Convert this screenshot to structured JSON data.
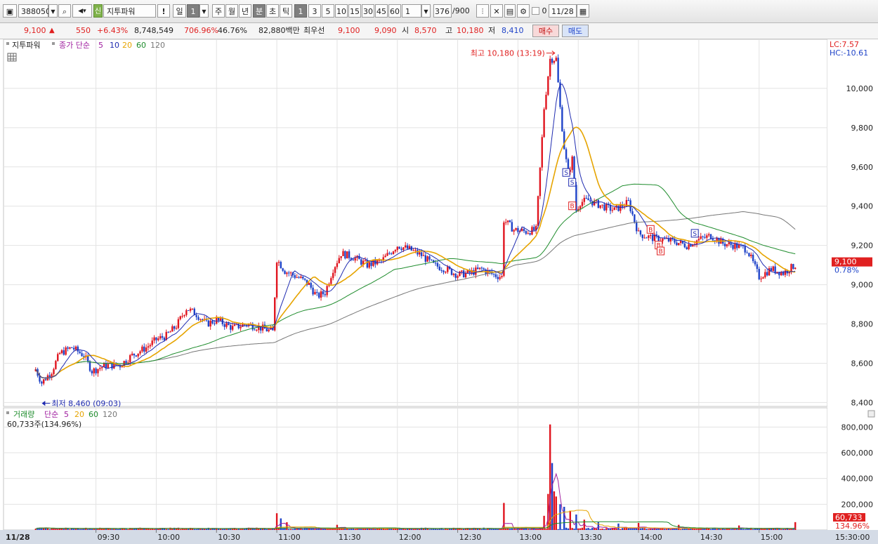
{
  "toolbar": {
    "code": "388050",
    "badge": "신",
    "name": "지투파워",
    "exclaim": "!",
    "period_day": "일",
    "period_day_num": "1",
    "period_week": "주",
    "period_month": "월",
    "period_year": "년",
    "period_minute": "분",
    "period_second": "초",
    "period_tick": "틱",
    "intervals": [
      "1",
      "3",
      "5",
      "10",
      "15",
      "30",
      "45",
      "60"
    ],
    "interval_input": "1",
    "count": "376",
    "count_total": "/900",
    "zero_label": "0",
    "date": "11/28"
  },
  "quote": {
    "price": "9,100",
    "change": "550",
    "change_pct": "+6.43%",
    "volume": "8,748,549",
    "volume_ratio": "706.96%",
    "turnover": "46.76%",
    "amount": "82,880백만",
    "best_label": "최우선",
    "ask": "9,100",
    "bid": "9,090",
    "open_label": "시",
    "open": "8,570",
    "high_label": "고",
    "high": "10,180",
    "low_label": "저",
    "low": "8,410",
    "buy_label": "매수",
    "sell_label": "매도"
  },
  "price_panel": {
    "title": "지투파워",
    "ma_label": "종가 단순",
    "ma_periods": [
      "5",
      "10",
      "20",
      "60",
      "120"
    ],
    "ma_colors": [
      "#1f2bb0",
      "#e6a400",
      "#1e8c2c",
      "#777777"
    ],
    "lc": "LC:7.57",
    "hc": "HC:-10.61",
    "high_annotation": "최고 10,180 (13:19)",
    "low_annotation": "최저 8,460 (09:03)",
    "current_price_tag": "9,100",
    "current_pct_tag": "0.78%",
    "signals": [
      "S",
      "S",
      "B",
      "B",
      "B",
      "B",
      "S"
    ]
  },
  "volume_panel": {
    "title": "거래량",
    "ma_label": "단순",
    "ma_periods": [
      "5",
      "20",
      "60",
      "120"
    ],
    "readout": "60,733주(134.96%)",
    "current_tag": "60,733",
    "current_pct_tag": "134.96%"
  },
  "time_axis": {
    "date_label": "11/28",
    "end_label": "15:30:00"
  },
  "colors": {
    "up": "#e0141e",
    "down": "#1f43c8",
    "accent": "#e02020"
  },
  "chart_data": [
    {
      "type": "candlestick",
      "title": "지투파워 1분",
      "x_ticks": [
        "09:30",
        "10:00",
        "10:30",
        "11:00",
        "11:30",
        "12:00",
        "12:30",
        "13:00",
        "13:30",
        "14:00",
        "14:30",
        "15:00"
      ],
      "y_ticks": [
        8400,
        8600,
        8800,
        9000,
        9200,
        9400,
        9600,
        9800,
        10000
      ],
      "ylim": [
        8380,
        10250
      ],
      "grid": true,
      "close_series": [
        [
          "09:00",
          8570
        ],
        [
          "09:03",
          8500
        ],
        [
          "09:08",
          8560
        ],
        [
          "09:12",
          8650
        ],
        [
          "09:18",
          8680
        ],
        [
          "09:24",
          8640
        ],
        [
          "09:28",
          8560
        ],
        [
          "09:35",
          8590
        ],
        [
          "09:42",
          8590
        ],
        [
          "09:48",
          8640
        ],
        [
          "09:55",
          8680
        ],
        [
          "10:00",
          8720
        ],
        [
          "10:05",
          8740
        ],
        [
          "10:10",
          8790
        ],
        [
          "10:15",
          8880
        ],
        [
          "10:20",
          8850
        ],
        [
          "10:25",
          8800
        ],
        [
          "10:30",
          8820
        ],
        [
          "10:38",
          8780
        ],
        [
          "10:45",
          8800
        ],
        [
          "10:52",
          8780
        ],
        [
          "10:58",
          8760
        ],
        [
          "11:00",
          9130
        ],
        [
          "11:04",
          9070
        ],
        [
          "11:08",
          9050
        ],
        [
          "11:12",
          9030
        ],
        [
          "11:16",
          9000
        ],
        [
          "11:20",
          8940
        ],
        [
          "11:24",
          8960
        ],
        [
          "11:28",
          9080
        ],
        [
          "11:32",
          9160
        ],
        [
          "11:38",
          9140
        ],
        [
          "11:45",
          9100
        ],
        [
          "11:52",
          9120
        ],
        [
          "12:00",
          9200
        ],
        [
          "12:06",
          9180
        ],
        [
          "12:12",
          9150
        ],
        [
          "12:18",
          9100
        ],
        [
          "12:24",
          9080
        ],
        [
          "12:30",
          9050
        ],
        [
          "12:36",
          9060
        ],
        [
          "12:42",
          9080
        ],
        [
          "12:48",
          9050
        ],
        [
          "12:52",
          9040
        ],
        [
          "12:53",
          9330
        ],
        [
          "12:58",
          9280
        ],
        [
          "13:04",
          9270
        ],
        [
          "13:09",
          9280
        ],
        [
          "13:13",
          9900
        ],
        [
          "13:16",
          10150
        ],
        [
          "13:19",
          10150
        ],
        [
          "13:21",
          9900
        ],
        [
          "13:23",
          9700
        ],
        [
          "13:25",
          9560
        ],
        [
          "13:27",
          9640
        ],
        [
          "13:29",
          9380
        ],
        [
          "13:31",
          9420
        ],
        [
          "13:35",
          9430
        ],
        [
          "13:42",
          9400
        ],
        [
          "13:48",
          9380
        ],
        [
          "13:55",
          9420
        ],
        [
          "14:00",
          9260
        ],
        [
          "14:06",
          9240
        ],
        [
          "14:12",
          9230
        ],
        [
          "14:18",
          9220
        ],
        [
          "14:24",
          9200
        ],
        [
          "14:30",
          9230
        ],
        [
          "14:36",
          9250
        ],
        [
          "14:42",
          9210
        ],
        [
          "14:48",
          9200
        ],
        [
          "14:54",
          9180
        ],
        [
          "15:00",
          9040
        ],
        [
          "15:06",
          9080
        ],
        [
          "15:12",
          9060
        ],
        [
          "15:18",
          9100
        ]
      ],
      "annotations": [
        {
          "text": "최고 10,180 (13:19)",
          "x": "13:19",
          "y": 10180
        },
        {
          "text": "최저 8,460 (09:03)",
          "x": "09:03",
          "y": 8460
        }
      ]
    },
    {
      "type": "bar",
      "title": "거래량",
      "y_ticks": [
        200000,
        400000,
        600000,
        800000
      ],
      "ylim": [
        0,
        840000
      ],
      "bars": [
        [
          "11:00",
          130000
        ],
        [
          "11:02",
          90000
        ],
        [
          "11:05",
          60000
        ],
        [
          "11:30",
          40000
        ],
        [
          "12:53",
          210000
        ],
        [
          "13:13",
          110000
        ],
        [
          "13:15",
          280000
        ],
        [
          "13:16",
          820000
        ],
        [
          "13:17",
          520000
        ],
        [
          "13:18",
          300000
        ],
        [
          "13:19",
          260000
        ],
        [
          "13:21",
          200000
        ],
        [
          "13:23",
          180000
        ],
        [
          "13:26",
          150000
        ],
        [
          "13:29",
          120000
        ],
        [
          "13:33",
          80000
        ],
        [
          "13:40",
          60000
        ],
        [
          "13:50",
          50000
        ],
        [
          "14:00",
          55000
        ],
        [
          "14:20",
          40000
        ],
        [
          "14:50",
          35000
        ],
        [
          "15:18",
          60733
        ]
      ]
    }
  ]
}
